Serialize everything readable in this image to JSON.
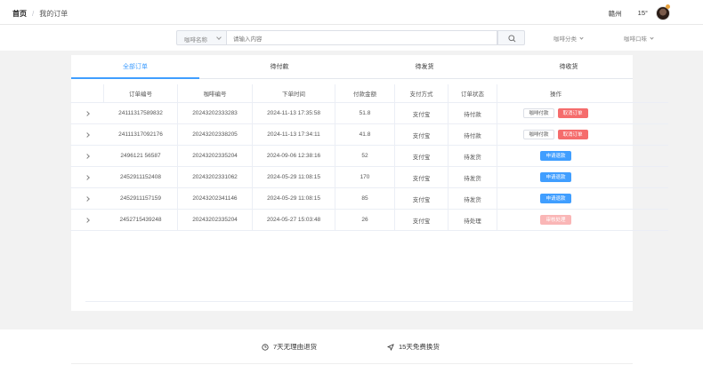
{
  "header": {
    "breadcrumb_home": "首页",
    "breadcrumb_sep": "/",
    "breadcrumb_current": "我的订单",
    "city": "赣州",
    "temperature": "15°"
  },
  "search": {
    "select_label": "咖啡名称",
    "placeholder": "请输入内容",
    "category_label": "咖啡分类",
    "flavor_label": "咖啡口味"
  },
  "tabs": [
    "全部订单",
    "待付款",
    "待发货",
    "待收货"
  ],
  "table": {
    "columns": [
      "订单编号",
      "咖啡编号",
      "下单时间",
      "付款金额",
      "支付方式",
      "订单状态",
      "操作"
    ],
    "rows": [
      {
        "order_no": "24111317589832",
        "coffee_no": "20243202333283",
        "time": "2024-11-13 17:35:58",
        "amount": "51.8",
        "pay": "支付宝",
        "status": "待付款",
        "actions": [
          "咖啡付款",
          "取消订单"
        ]
      },
      {
        "order_no": "24111317092176",
        "coffee_no": "20243202338205",
        "time": "2024-11-13 17:34:11",
        "amount": "41.8",
        "pay": "支付宝",
        "status": "待付款",
        "actions": [
          "咖啡付款",
          "取消订单"
        ]
      },
      {
        "order_no": "2496121 56587",
        "coffee_no": "20243202335204",
        "time": "2024-09-06 12:38:16",
        "amount": "52",
        "pay": "支付宝",
        "status": "待发货",
        "actions": [
          "申请退款"
        ]
      },
      {
        "order_no": "2452911152408",
        "coffee_no": "20243202331062",
        "time": "2024-05-29 11:08:15",
        "amount": "170",
        "pay": "支付宝",
        "status": "待发货",
        "actions": [
          "申请退款"
        ]
      },
      {
        "order_no": "2452911157159",
        "coffee_no": "20243202341146",
        "time": "2024-05-29 11:08:15",
        "amount": "85",
        "pay": "支付宝",
        "status": "待发货",
        "actions": [
          "申请退款"
        ]
      },
      {
        "order_no": "2452715439248",
        "coffee_no": "20243202335204",
        "time": "2024-05-27 15:03:48",
        "amount": "26",
        "pay": "支付宝",
        "status": "待处理",
        "actions": [
          "审核处理"
        ]
      }
    ]
  },
  "footer": {
    "item1": "7天无理由退货",
    "item2": "15天免费换货"
  },
  "colors": {
    "accent": "#409eff",
    "danger": "#f56c6c",
    "danger_light": "#fab6b6"
  }
}
